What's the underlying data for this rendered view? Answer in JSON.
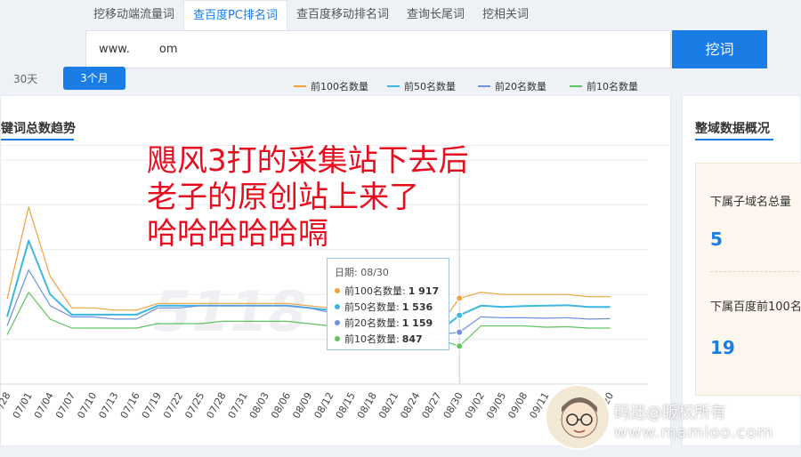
{
  "tabs": [
    {
      "label": "挖移动端流量词",
      "active": false
    },
    {
      "label": "查百度PC排名词",
      "active": true
    },
    {
      "label": "查百度移动排名词",
      "active": false
    },
    {
      "label": "查询长尾词",
      "active": false
    },
    {
      "label": "挖相关词",
      "active": false
    }
  ],
  "search": {
    "value": "www.        om",
    "button_label": "挖词"
  },
  "trend_panel": {
    "title": "键词总数趋势",
    "range_options": [
      "30天",
      "3个月"
    ],
    "selected_range": "3个月"
  },
  "overlay_text": [
    "飓风3打的采集站下去后",
    "老子的原创站上来了",
    "哈哈哈哈哈嗝"
  ],
  "chart_data": {
    "type": "line",
    "x": [
      "06/28",
      "07/01",
      "07/04",
      "07/07",
      "07/10",
      "07/13",
      "07/16",
      "07/19",
      "07/22",
      "07/25",
      "07/28",
      "07/31",
      "08/03",
      "08/06",
      "08/09",
      "08/12",
      "08/15",
      "08/18",
      "08/21",
      "08/24",
      "08/27",
      "08/30",
      "09/02",
      "09/05",
      "09/08",
      "09/11",
      "09/14",
      "09/17",
      "09/20"
    ],
    "x_labels_visible": [
      "06/28",
      "07/01",
      "07/04",
      "07/07",
      "07/10",
      "07/13",
      "07/16",
      "07/19",
      "07/22",
      "07/25",
      "07/28",
      "07/31",
      "08/03",
      "08/06",
      "08/09",
      "08/12",
      "08/15",
      "08/18",
      "08/21",
      "08/24",
      "08/27",
      "08/30",
      "09/02",
      "09/05",
      "09/08",
      "09/11",
      "09/14",
      "09/17",
      "09/20"
    ],
    "x_labels_printed": [
      "/28",
      "07/01",
      "07/04",
      "07/07",
      "07/10",
      "07/13",
      "07/16",
      "07/19",
      "07/22",
      "07/25",
      "07/28",
      "07/31",
      "08/03",
      "08/06",
      "08/09",
      "08/12",
      "08/15",
      "08/18",
      "08/21",
      "08/24",
      "08/27",
      "08/30",
      "09/02",
      "09/05",
      "09/08",
      "09/11",
      "",
      "",
      "09/20"
    ],
    "ylim": [
      0,
      5000
    ],
    "grid": true,
    "legend": "top-right",
    "series": [
      {
        "name": "前100名数量",
        "color": "#f0a23c",
        "values": [
          1900,
          3950,
          2400,
          1700,
          1700,
          1650,
          1650,
          1800,
          1800,
          1800,
          1800,
          1800,
          1800,
          1800,
          1750,
          1700,
          1600,
          1500,
          1400,
          1350,
          1250,
          1917,
          2050,
          2000,
          2000,
          2000,
          2000,
          1950,
          1950
        ]
      },
      {
        "name": "前50名数量",
        "color": "#3cb8e0",
        "values": [
          1500,
          3200,
          2000,
          1550,
          1550,
          1550,
          1550,
          1750,
          1750,
          1750,
          1750,
          1750,
          1750,
          1750,
          1700,
          1650,
          1500,
          1400,
          1300,
          1250,
          1150,
          1536,
          1750,
          1720,
          1740,
          1750,
          1760,
          1720,
          1720
        ]
      },
      {
        "name": "前20名数量",
        "color": "#6f8fe0",
        "values": [
          1300,
          2550,
          1750,
          1500,
          1500,
          1450,
          1450,
          1700,
          1700,
          1750,
          1750,
          1750,
          1750,
          1750,
          1700,
          1600,
          1450,
          1350,
          1300,
          1200,
          1100,
          1159,
          1500,
          1480,
          1480,
          1470,
          1480,
          1450,
          1460
        ]
      },
      {
        "name": "前10名数量",
        "color": "#5fc35f",
        "values": [
          1100,
          2050,
          1450,
          1250,
          1250,
          1250,
          1250,
          1350,
          1350,
          1350,
          1400,
          1400,
          1400,
          1400,
          1350,
          1300,
          1250,
          1150,
          1100,
          1050,
          1000,
          847,
          1300,
          1300,
          1300,
          1270,
          1280,
          1250,
          1250
        ]
      }
    ],
    "tooltip": {
      "date": "日期: 08/30",
      "rows": [
        {
          "label": "前100名数量:",
          "value": "1 917",
          "color": "#f0a23c"
        },
        {
          "label": "前50名数量:",
          "value": "1 536",
          "color": "#3cb8e0"
        },
        {
          "label": "前20名数量:",
          "value": "1 159",
          "color": "#6f8fe0"
        },
        {
          "label": "前10名数量:",
          "value": "847",
          "color": "#5fc35f"
        }
      ]
    },
    "background_watermark": "5118"
  },
  "legend_labels": [
    "前100名数量",
    "前50名数量",
    "前20名数量",
    "前10名数量"
  ],
  "domain_overview": {
    "title": "整域数据概况",
    "subdomain_label": "下属子域名总量",
    "subdomain_value": "5",
    "top100_label": "下属百度前100名",
    "top100_value": "19  "
  },
  "watermark": {
    "text": "码迷@版权所有",
    "url": "www.mamioo.com"
  }
}
